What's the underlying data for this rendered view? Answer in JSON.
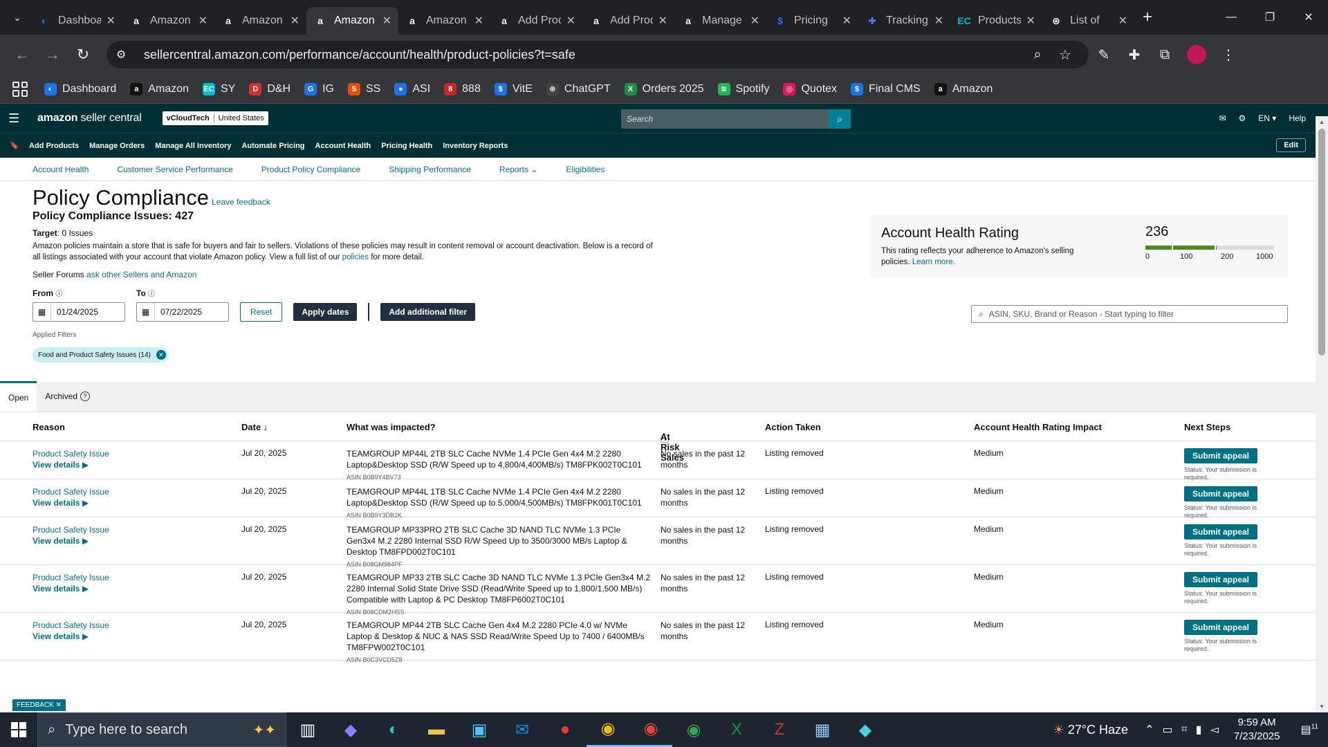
{
  "browser": {
    "tabs": [
      {
        "title": "Dashboard",
        "icon": "dashboard-icon",
        "color": "#1a73e8",
        "glyph": "◐"
      },
      {
        "title": "Amazon",
        "icon": "amazon-icon",
        "color": "#ffffff",
        "glyph": "a"
      },
      {
        "title": "Amazon",
        "icon": "amazon-icon",
        "color": "#ffffff",
        "glyph": "a"
      },
      {
        "title": "Amazon",
        "icon": "amazon-icon",
        "color": "#ffffff",
        "glyph": "a",
        "active": true
      },
      {
        "title": "Amazon",
        "icon": "amazon-icon",
        "color": "#ffffff",
        "glyph": "a"
      },
      {
        "title": "Add Products",
        "icon": "amazon-icon",
        "color": "#ffffff",
        "glyph": "a"
      },
      {
        "title": "Add Products",
        "icon": "amazon-icon",
        "color": "#ffffff",
        "glyph": "a"
      },
      {
        "title": "Manage",
        "icon": "amazon-icon",
        "color": "#ffffff",
        "glyph": "a"
      },
      {
        "title": "Pricing",
        "icon": "dollar-icon",
        "color": "#1a73e8",
        "glyph": "$"
      },
      {
        "title": "Tracking",
        "icon": "tracking-icon",
        "color": "#4285f4",
        "glyph": "✚"
      },
      {
        "title": "Products",
        "icon": "ec-icon",
        "color": "#00bcd4",
        "glyph": "EC"
      },
      {
        "title": "List of",
        "icon": "chatgpt-icon",
        "color": "#ffffff",
        "glyph": "⊛"
      }
    ],
    "url": "sellercentral.amazon.com/performance/account/health/product-policies?t=safe",
    "bookmarks": [
      {
        "label": "Dashboard",
        "color": "#1a73e8",
        "glyph": "◐"
      },
      {
        "label": "Amazon",
        "color": "#111111",
        "glyph": "a"
      },
      {
        "label": "SY",
        "color": "#00bcd4",
        "glyph": "EC"
      },
      {
        "label": "D&H",
        "color": "#d32f2f",
        "glyph": "D"
      },
      {
        "label": "IG",
        "color": "#1a73e8",
        "glyph": "G"
      },
      {
        "label": "SS",
        "color": "#e65100",
        "glyph": "S"
      },
      {
        "label": "ASI",
        "color": "#1a73e8",
        "glyph": "●"
      },
      {
        "label": "888",
        "color": "#c62828",
        "glyph": "8"
      },
      {
        "label": "VitE",
        "color": "#1a73e8",
        "glyph": "$"
      },
      {
        "label": "ChatGPT",
        "color": "#444444",
        "glyph": "⊛"
      },
      {
        "label": "Orders 2025",
        "color": "#1e8e3e",
        "glyph": "X"
      },
      {
        "label": "Spotify",
        "color": "#1db954",
        "glyph": "≋"
      },
      {
        "label": "Quotex",
        "color": "#d81b60",
        "glyph": "◎"
      },
      {
        "label": "Final CMS",
        "color": "#1a73e8",
        "glyph": "$"
      },
      {
        "label": "Amazon",
        "color": "#111111",
        "glyph": "a"
      }
    ]
  },
  "header": {
    "logo_bold": "amazon",
    "logo_rest": " seller central",
    "account": "vCloudTech",
    "marketplace": "United States",
    "search_placeholder": "Search",
    "lang": "EN ▾",
    "help": "Help"
  },
  "nav": {
    "items": [
      "Add Products",
      "Manage Orders",
      "Manage All Inventory",
      "Automate Pricing",
      "Account Health",
      "Pricing Health",
      "Inventory Reports"
    ],
    "edit": "Edit"
  },
  "subnav": [
    "Account Health",
    "Customer Service Performance",
    "Product Policy Compliance",
    "Shipping Performance",
    "Reports ⌄",
    "Eligibilities"
  ],
  "page": {
    "title": "Policy Compliance",
    "feedback_link": "Leave feedback",
    "issues": "Policy Compliance Issues: 427",
    "target_label": "Target",
    "target_value": ": 0 Issues",
    "desc_1": "Amazon policies maintain a store that is safe for buyers and fair to sellers. Violations of these policies may result in content removal or account deactivation. Below is a record of all listings associated with your account that violate Amazon policy. View a full list of our ",
    "desc_link": "policies",
    "desc_2": " for more detail.",
    "forums_label": "Seller Forums ",
    "forums_link": "ask other Sellers and Amazon"
  },
  "filters": {
    "from_label": "From",
    "to_label": "To",
    "from": "01/24/2025",
    "to": "07/22/2025",
    "reset": "Reset",
    "apply": "Apply dates",
    "add_filter": "Add additional filter",
    "search_placeholder": "ASIN, SKU, Brand or Reason - Start typing to filter",
    "applied_label": "Applied Filters",
    "chip": "Food and Product Safety Issues (14)"
  },
  "ahr": {
    "title": "Account Health Rating",
    "desc": "This rating reflects your adherence to Amazon's selling policies. ",
    "learn": "Learn more.",
    "score": "236",
    "score_value": 236,
    "ticks": [
      "0",
      "100",
      "200",
      "1000"
    ]
  },
  "tabs": {
    "open": "Open",
    "archived": "Archived"
  },
  "table": {
    "headers": {
      "reason": "Reason",
      "date": "Date ↓",
      "what": "What was impacted?",
      "risk": "At Risk Sales",
      "action": "Action Taken",
      "impact": "Account Health Rating Impact",
      "next": "Next Steps"
    },
    "rows": [
      {
        "reason": "Product Safety Issue",
        "view": "View details ▶",
        "date": "Jul 20, 2025",
        "product": "TEAMGROUP MP44L 2TB SLC Cache NVMe 1.4 PCIe Gen 4x4 M.2 2280 Laptop&Desktop SSD (R/W Speed up to 4,800/4,400MB/s) TM8FPK002T0C101",
        "asin": "ASIN B0B9Y4BV73",
        "risk": "No sales in the past 12 months",
        "action": "Listing removed",
        "impact": "Medium",
        "btn": "Submit appeal",
        "status": "Status: Your submission is required."
      },
      {
        "reason": "Product Safety Issue",
        "view": "View details ▶",
        "date": "Jul 20, 2025",
        "product": "TEAMGROUP MP44L 1TB SLC Cache NVMe 1.4 PCIe Gen 4x4 M.2 2280 Laptop&Desktop SSD (R/W Speed up to 5,000/4,500MB/s) TM8FPK001T0C101",
        "asin": "ASIN B0B9Y3DB2K",
        "risk": "No sales in the past 12 months",
        "action": "Listing removed",
        "impact": "Medium",
        "btn": "Submit appeal",
        "status": "Status: Your submission is required."
      },
      {
        "reason": "Product Safety Issue",
        "view": "View details ▶",
        "date": "Jul 20, 2025",
        "product": "TEAMGROUP MP33PRO 2TB SLC Cache 3D NAND TLC NVMe 1.3 PCIe Gen3x4 M.2 2280 Internal SSD R/W Speed Up to 3500/3000 MB/s Laptop & Desktop TM8FPD002T0C101",
        "asin": "ASIN B08GM984PF",
        "risk": "No sales in the past 12 months",
        "action": "Listing removed",
        "impact": "Medium",
        "btn": "Submit appeal",
        "status": "Status: Your submission is required."
      },
      {
        "reason": "Product Safety Issue",
        "view": "View details ▶",
        "date": "Jul 20, 2025",
        "product": "TEAMGROUP MP33 2TB SLC Cache 3D NAND TLC NVMe 1.3 PCIe Gen3x4 M.2 2280 Internal Solid State Drive SSD (Read/Write Speed up to 1,800/1,500 MB/s) Compatible with Laptop & PC Desktop TM8FP6002T0C101",
        "asin": "ASIN B08CDM2HSS",
        "risk": "No sales in the past 12 months",
        "action": "Listing removed",
        "impact": "Medium",
        "btn": "Submit appeal",
        "status": "Status: Your submission is required."
      },
      {
        "reason": "Product Safety Issue",
        "view": "View details ▶",
        "date": "Jul 20, 2025",
        "product": "TEAMGROUP MP44 2TB SLC Cache Gen 4x4 M.2 2280 PCIe 4.0 w/ NVMe Laptop & Desktop & NUC & NAS SSD Read/Write Speed Up to 7400 / 6400MB/s TM8FPW002T0C101",
        "asin": "ASIN B0C3VCD5Z8",
        "risk": "No sales in the past 12 months",
        "action": "Listing removed",
        "impact": "Medium",
        "btn": "Submit appeal",
        "status": "Status: Your submission is required."
      }
    ]
  },
  "feedback_tab": "FEEDBACK ✕",
  "taskbar": {
    "search_placeholder": "Type here to search",
    "weather": "27°C  Haze",
    "time": "9:59 AM",
    "date": "7/23/2025",
    "notif": "11"
  }
}
